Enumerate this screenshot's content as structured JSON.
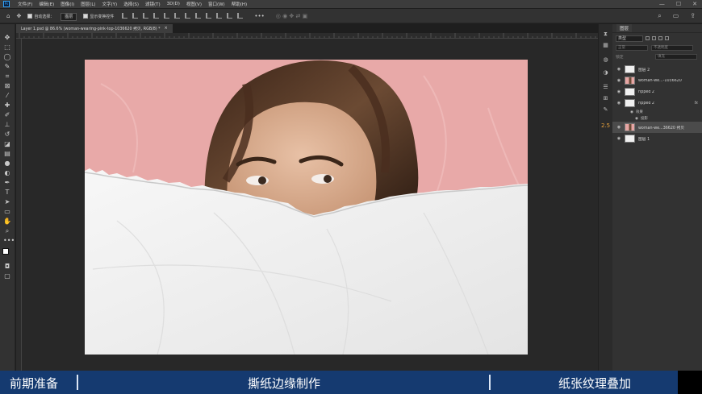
{
  "menubar": {
    "app_icon": "Ps",
    "items": [
      "文件(F)",
      "编辑(E)",
      "图像(I)",
      "图层(L)",
      "文字(Y)",
      "选择(S)",
      "滤镜(T)",
      "3D(D)",
      "视图(V)",
      "窗口(W)",
      "帮助(H)"
    ],
    "controls": [
      "—",
      "☐",
      "✕"
    ]
  },
  "options": {
    "auto_select_label": "自动选择：",
    "auto_select_value": "图层",
    "show_transform_label": "显示变换控件"
  },
  "document": {
    "tab_title": "Layer 1.psd @ 86.6% (woman-wearing-pink-top-1036620 拷贝, RGB/8) *",
    "close": "×"
  },
  "layers_panel": {
    "tab": "图层",
    "filter": "类型",
    "mode": "正常",
    "opacity_label": "不透明度",
    "lock_label": "锁定",
    "fill_label": "填充",
    "layers": [
      {
        "name": "图层 2",
        "thumb": "paper",
        "selected": false,
        "fx": false
      },
      {
        "name": "woman-we...-1036620",
        "thumb": "photo",
        "selected": false,
        "fx": false
      },
      {
        "name": "ripped 2",
        "thumb": "paper",
        "selected": false,
        "fx": false
      },
      {
        "name": "ripped 2",
        "thumb": "paper",
        "selected": false,
        "fx": true
      },
      {
        "name": "woman-we...36620 拷贝",
        "thumb": "photo",
        "selected": true,
        "fx": false
      },
      {
        "name": "图层 1",
        "thumb": "paper",
        "selected": false,
        "fx": false
      }
    ],
    "effects_label": "效果",
    "effect_item": "投影"
  },
  "captions": {
    "left": "前期准备",
    "center": "撕纸边缘制作",
    "right": "纸张纹理叠加"
  }
}
